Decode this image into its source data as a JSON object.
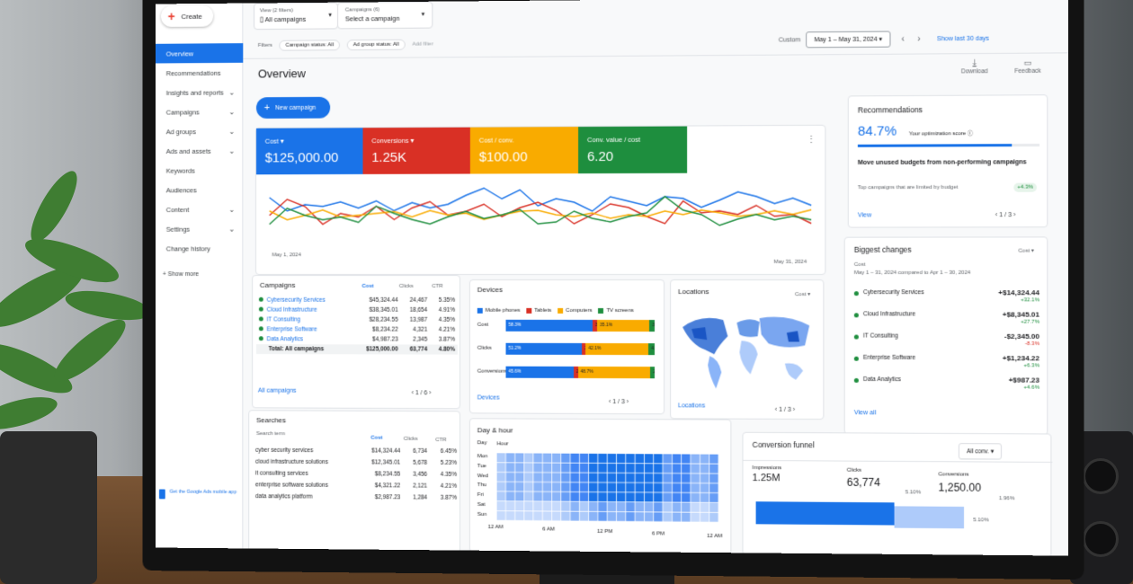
{
  "header": {
    "create": "Create",
    "view_label": "View (2 filters)",
    "view_value": "All campaigns",
    "campaigns_label": "Campaigns (6)",
    "campaigns_value": "Select a campaign",
    "filters": "Filters",
    "chip1": "Campaign status: All",
    "chip2": "Ad group status: All",
    "add_filter": "Add filter",
    "custom": "Custom",
    "date_range": "May 1 – May 31, 2024",
    "show_last": "Show last 30 days"
  },
  "nav": {
    "items": [
      {
        "label": "Overview"
      },
      {
        "label": "Recommendations"
      },
      {
        "label": "Insights and reports"
      },
      {
        "label": "Campaigns"
      },
      {
        "label": "Ad groups"
      },
      {
        "label": "Ads and assets"
      },
      {
        "label": "Keywords"
      },
      {
        "label": "Audiences"
      },
      {
        "label": "Content"
      },
      {
        "label": "Settings"
      },
      {
        "label": "Change history"
      }
    ],
    "show_more": "Show more",
    "app_promo": "Get the Google Ads mobile app"
  },
  "page": {
    "title": "Overview",
    "download": "Download",
    "feedback": "Feedback",
    "new_campaign": "New campaign"
  },
  "metrics": [
    {
      "label": "Cost",
      "value": "$125,000.00",
      "color": "#1a73e8"
    },
    {
      "label": "Conversions",
      "value": "1.25K",
      "color": "#d93025"
    },
    {
      "label": "Cost / conv.",
      "value": "$100.00",
      "color": "#f9ab00"
    },
    {
      "label": "Conv. value / cost",
      "value": "6.20",
      "color": "#1e8e3e"
    }
  ],
  "chart": {
    "start": "May 1, 2024",
    "end": "May 31, 2024"
  },
  "chart_data": {
    "type": "line",
    "x_range": [
      "May 1, 2024",
      "May 31, 2024"
    ],
    "series": [
      {
        "color": "#1a73e8",
        "values": [
          60,
          45,
          52,
          50,
          55,
          48,
          56,
          45,
          54,
          48,
          52,
          62,
          70,
          58,
          68,
          50,
          58,
          54,
          44,
          60,
          55,
          50,
          60,
          58,
          48,
          56,
          65,
          60,
          52,
          58,
          50
        ]
      },
      {
        "color": "#d93025",
        "values": [
          40,
          58,
          50,
          30,
          42,
          38,
          50,
          35,
          48,
          55,
          40,
          44,
          52,
          38,
          48,
          54,
          45,
          30,
          40,
          52,
          48,
          38,
          30,
          55,
          42,
          44,
          40,
          50,
          38,
          40,
          30
        ]
      },
      {
        "color": "#f9ab00",
        "values": [
          45,
          35,
          40,
          46,
          38,
          40,
          42,
          44,
          38,
          45,
          40,
          42,
          35,
          40,
          44,
          45,
          40,
          38,
          42,
          36,
          40,
          38,
          44,
          40,
          45,
          42,
          38,
          40,
          44,
          40,
          45
        ]
      },
      {
        "color": "#1e8e3e",
        "values": [
          30,
          48,
          40,
          35,
          38,
          32,
          50,
          42,
          35,
          30,
          38,
          44,
          36,
          40,
          46,
          30,
          32,
          44,
          36,
          32,
          38,
          42,
          60,
          45,
          40,
          28,
          35,
          40,
          34,
          38,
          34
        ]
      }
    ]
  },
  "campaigns": {
    "title": "Campaigns",
    "headers": [
      "Cost",
      "Clicks",
      "CTR"
    ],
    "rows": [
      {
        "name": "Cybersecurity Services",
        "cost": "$45,324.44",
        "clicks": "24,467",
        "ctr": "5.35%"
      },
      {
        "name": "Cloud Infrastructure",
        "cost": "$38,345.01",
        "clicks": "18,654",
        "ctr": "4.91%"
      },
      {
        "name": "IT Consulting",
        "cost": "$28,234.55",
        "clicks": "13,987",
        "ctr": "4.35%"
      },
      {
        "name": "Enterprise Software",
        "cost": "$8,234.22",
        "clicks": "4,321",
        "ctr": "4.21%"
      },
      {
        "name": "Data Analytics",
        "cost": "$4,987.23",
        "clicks": "2,345",
        "ctr": "3.87%"
      }
    ],
    "total": {
      "name": "Total: All campaigns",
      "cost": "$125,000.00",
      "clicks": "63,774",
      "ctr": "4.80%"
    },
    "link": "All campaigns",
    "pager": "1 / 6"
  },
  "devices": {
    "title": "Devices",
    "legend": [
      "Mobile phones",
      "Tablets",
      "Computers",
      "TV screens"
    ],
    "rows": [
      {
        "label": "Cost",
        "segs": [
          "58.3%",
          "3.2%",
          "35.1%",
          "3.4%"
        ],
        "vals": [
          58.3,
          3.2,
          35.1,
          3.4
        ]
      },
      {
        "label": "Clicks",
        "segs": [
          "51.2%",
          "2.6%",
          "42.1%",
          "4.1%"
        ],
        "vals": [
          51.2,
          2.6,
          42.1,
          4.1
        ]
      },
      {
        "label": "Conversions",
        "segs": [
          "45.6%",
          "2.9%",
          "48.7%",
          "2.8%"
        ],
        "vals": [
          45.6,
          2.9,
          48.7,
          2.8
        ]
      }
    ],
    "link": "Devices",
    "pager": "1 / 3"
  },
  "locations": {
    "title": "Locations",
    "metric": "Cost",
    "link": "Locations",
    "pager": "1 / 3"
  },
  "recommendations": {
    "title": "Recommendations",
    "score": "84.7%",
    "score_label": "Your optimization score",
    "score_value": 0.847,
    "item_title": "Move unused budgets from non-performing campaigns",
    "item_sub": "Top campaigns that are limited by budget",
    "item_badge": "+4.3%",
    "link": "View",
    "pager": "1 / 3"
  },
  "changes": {
    "title": "Biggest changes",
    "metric": "Cost",
    "metric_label": "Cost",
    "range": "May 1 – 31, 2024 compared to Apr 1 – 30, 2024",
    "rows": [
      {
        "name": "Cybersecurity Services",
        "value": "+$14,324.44",
        "pct": "+32.1%",
        "dir": "up"
      },
      {
        "name": "Cloud Infrastructure",
        "value": "+$8,345.01",
        "pct": "+27.7%",
        "dir": "up"
      },
      {
        "name": "IT Consulting",
        "value": "-$2,345.00",
        "pct": "-8.3%",
        "dir": "down"
      },
      {
        "name": "Enterprise Software",
        "value": "+$1,234.22",
        "pct": "+6.3%",
        "dir": "up"
      },
      {
        "name": "Data Analytics",
        "value": "+$987.23",
        "pct": "+4.6%",
        "dir": "up"
      }
    ],
    "link": "View all"
  },
  "searches": {
    "title": "Searches",
    "col": "Search term",
    "headers": [
      "Cost",
      "Clicks",
      "CTR"
    ],
    "rows": [
      {
        "term": "cyber security services",
        "cost": "$14,324.44",
        "clicks": "6,734",
        "ctr": "6.45%"
      },
      {
        "term": "cloud infrastructure solutions",
        "cost": "$12,345.01",
        "clicks": "5,678",
        "ctr": "5.23%"
      },
      {
        "term": "it consulting services",
        "cost": "$8,234.55",
        "clicks": "3,456",
        "ctr": "4.35%"
      },
      {
        "term": "enterprise software solutions",
        "cost": "$4,321.22",
        "clicks": "2,121",
        "ctr": "4.21%"
      },
      {
        "term": "data analytics platform",
        "cost": "$2,987.23",
        "clicks": "1,284",
        "ctr": "3.87%"
      }
    ]
  },
  "dayhour": {
    "title": "Day & hour",
    "day": "Day",
    "hour": "Hour",
    "days": [
      "Mon",
      "Tue",
      "Wed",
      "Thu",
      "Fri",
      "Sat",
      "Sun"
    ],
    "hours": [
      "12 AM",
      "6 AM",
      "12 PM",
      "6 PM",
      "12 AM"
    ]
  },
  "funnel": {
    "title": "Conversion funnel",
    "selector": "All conv.",
    "impressions_label": "Impressions",
    "impressions": "1.25M",
    "clicks_label": "Clicks",
    "clicks": "63,774",
    "conversions_label": "Conversions",
    "conversions": "1,250.00",
    "rate1": "5.10%",
    "rate2": "1.96%",
    "rate3": "5.10%"
  }
}
